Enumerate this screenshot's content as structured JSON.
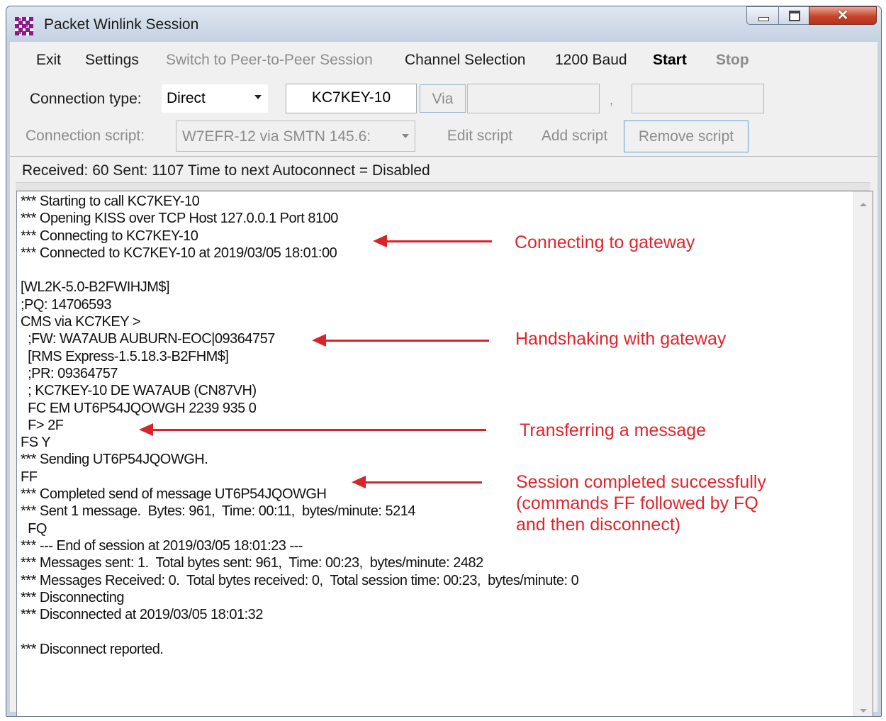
{
  "window": {
    "title": "Packet Winlink Session",
    "controls": {
      "minimize": "minimize-icon",
      "maximize": "maximize-icon",
      "close": "close-icon"
    }
  },
  "menu": {
    "exit": "Exit",
    "settings": "Settings",
    "peer_to_peer": "Switch to Peer-to-Peer Session",
    "channel_selection": "Channel Selection",
    "baud": "1200 Baud",
    "start": "Start",
    "stop": "Stop"
  },
  "connection": {
    "type_label": "Connection type:",
    "type_value": "Direct",
    "callsign": "KC7KEY-10",
    "via_label": "Via",
    "via_value": "",
    "comma": ",",
    "extra_value": ""
  },
  "script": {
    "label": "Connection script:",
    "value": "W7EFR-12 via SMTN 145.6:",
    "edit": "Edit script",
    "add": "Add script",
    "remove": "Remove script"
  },
  "status": {
    "text": "Received: 60  Sent: 1107  Time to next Autoconnect = Disabled"
  },
  "log": {
    "lines": [
      "*** Starting to call KC7KEY-10",
      "*** Opening KISS over TCP Host 127.0.0.1 Port 8100",
      "*** Connecting to KC7KEY-10",
      "*** Connected to KC7KEY-10 at 2019/03/05 18:01:00",
      "",
      "[WL2K-5.0-B2FWIHJM$]",
      ";PQ: 14706593",
      "CMS via KC7KEY >",
      "  ;FW: WA7AUB AUBURN-EOC|09364757",
      "  [RMS Express-1.5.18.3-B2FHM$]",
      "  ;PR: 09364757",
      "  ; KC7KEY-10 DE WA7AUB (CN87VH)",
      "  FC EM UT6P54JQOWGH 2239 935 0",
      "  F> 2F",
      "FS Y",
      "*** Sending UT6P54JQOWGH.",
      "FF",
      "*** Completed send of message UT6P54JQOWGH",
      "*** Sent 1 message.  Bytes: 961,  Time: 00:11,  bytes/minute: 5214",
      "  FQ",
      "*** --- End of session at 2019/03/05 18:01:23 ---",
      "*** Messages sent: 1.  Total bytes sent: 961,  Time: 00:23,  bytes/minute: 2482",
      "*** Messages Received: 0.  Total bytes received: 0,  Total session time: 00:23,  bytes/minute: 0",
      "*** Disconnecting",
      "*** Disconnected at 2019/03/05 18:01:32",
      "",
      "*** Disconnect reported."
    ]
  },
  "annotations": {
    "connecting": "Connecting to gateway",
    "handshaking": "Handshaking with gateway",
    "transferring": "Transferring a message",
    "completed_1": "Session completed successfully",
    "completed_2": "(commands FF followed by FQ",
    "completed_3": "and then disconnect)",
    "color": "#e0242b"
  }
}
